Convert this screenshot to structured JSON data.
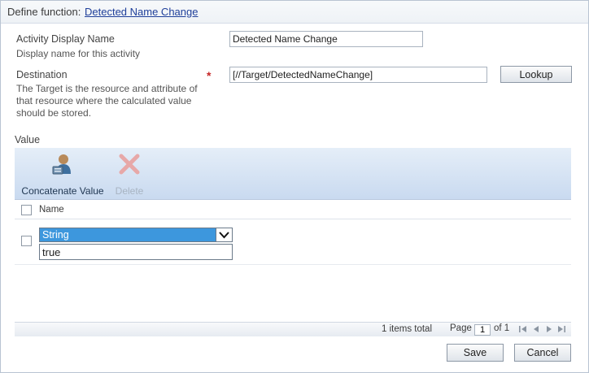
{
  "header": {
    "label": "Define function:",
    "link": "Detected Name Change"
  },
  "fields": {
    "display_name": {
      "label": "Activity Display Name",
      "description": "Display name for this activity",
      "value": "Detected Name Change"
    },
    "destination": {
      "label": "Destination",
      "required_marker": "*",
      "description": "The Target is the resource and attribute of that resource where the calculated value should be stored.",
      "value": "[//Target/DetectedNameChange]",
      "lookup_label": "Lookup"
    }
  },
  "value_section": {
    "label": "Value",
    "toolbar": {
      "concatenate_label": "Concatenate Value",
      "delete_label": "Delete"
    },
    "grid": {
      "column_name": "Name",
      "rows": [
        {
          "type": "String",
          "value": "true"
        }
      ]
    },
    "pager": {
      "total_text": "1 items total",
      "page_label": "Page",
      "page_number": "1",
      "of_text": "of 1"
    }
  },
  "buttons": {
    "save": "Save",
    "cancel": "Cancel"
  },
  "colors": {
    "link": "#1f3f9a",
    "required": "#c62828",
    "toolbar_top": "#e5eef8",
    "toolbar_bottom": "#c9daf0",
    "select_highlight": "#3d97dd"
  },
  "icons": [
    "user-add-icon",
    "delete-x-icon",
    "chevron-down-icon",
    "first-page-icon",
    "prev-page-icon",
    "next-page-icon",
    "last-page-icon"
  ]
}
